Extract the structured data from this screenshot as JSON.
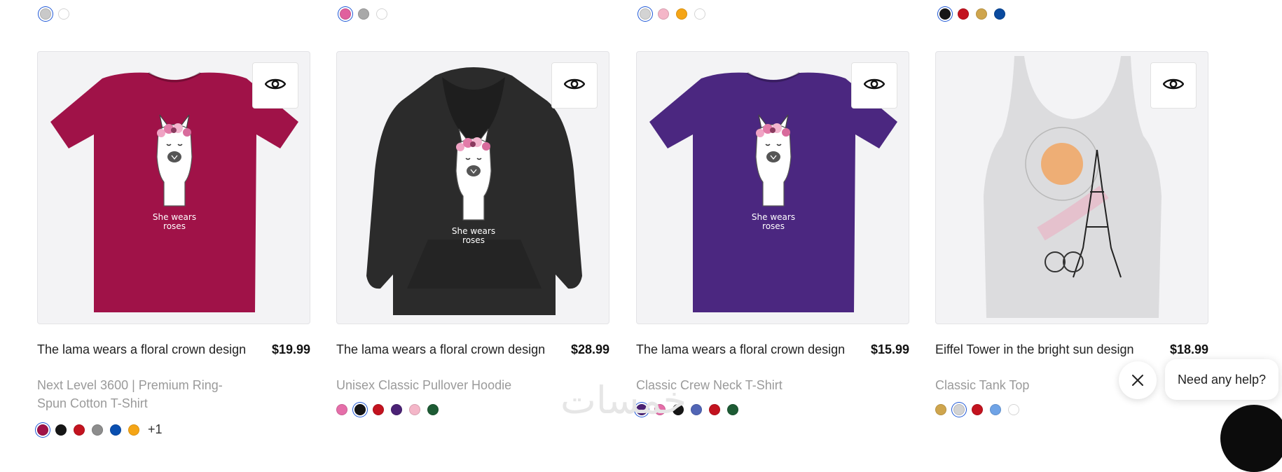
{
  "top_swatches": [
    [
      {
        "color": "#c9c9c9",
        "selected": true
      },
      {
        "color": "#ffffff",
        "light": true
      }
    ],
    [
      {
        "color": "#e0609e",
        "selected": true
      },
      {
        "color": "#a9a9a9"
      },
      {
        "color": "#ffffff",
        "light": true
      }
    ],
    [
      {
        "color": "#d3d3d3",
        "selected": true
      },
      {
        "color": "#f4b6c8"
      },
      {
        "color": "#f5a516"
      },
      {
        "color": "#ffffff",
        "light": true
      }
    ],
    [
      {
        "color": "#161616",
        "selected": true
      },
      {
        "color": "#c3131f"
      },
      {
        "color": "#cfa54d"
      },
      {
        "color": "#0a4a9e"
      }
    ]
  ],
  "products": [
    {
      "title": "The lama wears a floral crown design",
      "price": "$19.99",
      "type": "Next Level 3600 | Premium Ring-Spun Cotton T-Shirt",
      "garment_color": "#a01248",
      "garment": "tshirt",
      "design_text_1": "She wears",
      "design_text_2": "roses",
      "quick_view_icon": "eye-icon",
      "swatches": [
        {
          "color": "#a01248",
          "selected": true
        },
        {
          "color": "#161616"
        },
        {
          "color": "#c3131f"
        },
        {
          "color": "#8d8d8d"
        },
        {
          "color": "#0a4fb0"
        },
        {
          "color": "#f5a516"
        }
      ],
      "more": "+1"
    },
    {
      "title": "The lama wears a floral crown design",
      "price": "$28.99",
      "type": "Unisex Classic Pullover Hoodie",
      "garment_color": "#2b2b2b",
      "garment": "hoodie",
      "design_text_1": "She wears",
      "design_text_2": "roses",
      "quick_view_icon": "eye-icon",
      "swatches": [
        {
          "color": "#e56ea9"
        },
        {
          "color": "#161616",
          "selected": true
        },
        {
          "color": "#c3131f"
        },
        {
          "color": "#4b2275"
        },
        {
          "color": "#f4b6c8"
        },
        {
          "color": "#1d5b34"
        }
      ],
      "more": ""
    },
    {
      "title": "The lama wears a floral crown design",
      "price": "$15.99",
      "type": "Classic Crew Neck T-Shirt",
      "garment_color": "#4b2780",
      "garment": "tshirt",
      "design_text_1": "She wears",
      "design_text_2": "roses",
      "quick_view_icon": "eye-icon",
      "swatches": [
        {
          "color": "#4b2275",
          "selected": true
        },
        {
          "color": "#e56ea9"
        },
        {
          "color": "#161616"
        },
        {
          "color": "#5165b5"
        },
        {
          "color": "#c3131f"
        },
        {
          "color": "#1d5b34"
        }
      ],
      "more": ""
    },
    {
      "title": "Eiffel Tower in the bright sun design",
      "price": "$18.99",
      "type": "Classic Tank Top",
      "garment_color": "#dcdcde",
      "garment": "tank",
      "design_text_1": "",
      "design_text_2": "",
      "quick_view_icon": "eye-icon",
      "swatches": [
        {
          "color": "#cfa54d"
        },
        {
          "color": "#d3d3d3",
          "selected": true
        },
        {
          "color": "#c3131f"
        },
        {
          "color": "#6fa3e6"
        },
        {
          "color": "#ffffff",
          "light": true
        }
      ],
      "more": ""
    }
  ],
  "watermark": "خمسات",
  "help": {
    "text": "Need any help?",
    "close_icon": "close-icon"
  }
}
